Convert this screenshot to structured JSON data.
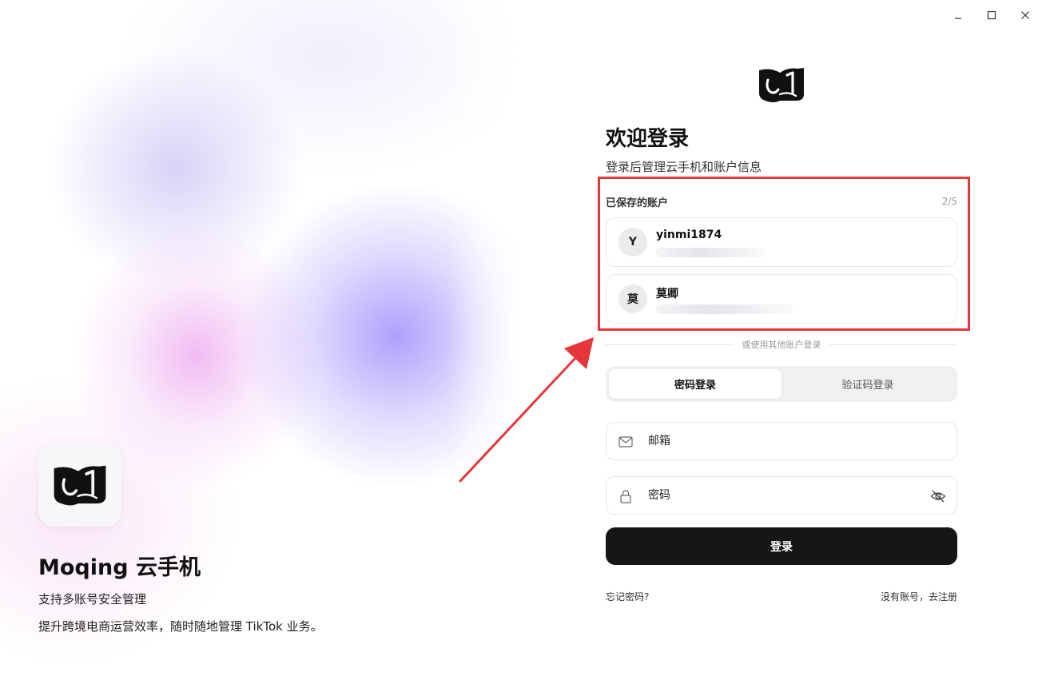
{
  "window": {
    "minimize_icon": "minimize-icon",
    "maximize_icon": "maximize-icon",
    "close_icon": "close-icon"
  },
  "hero": {
    "title": "Moqing 云手机",
    "subtitle1": "支持多账号安全管理",
    "subtitle2": "提升跨境电商运营效率，随时随地管理 TikTok 业务。",
    "logo_icon": "moqing-logo"
  },
  "login": {
    "title": "欢迎登录",
    "subtitle": "登录后管理云手机和账户信息",
    "saved_accounts": {
      "label": "已保存的账户",
      "count": "2/5",
      "items": [
        {
          "avatar": "Y",
          "name": "yinmi1874"
        },
        {
          "avatar": "莫",
          "name": "莫卿"
        }
      ]
    },
    "divider_text": "或使用其他账户登录",
    "tabs": [
      {
        "label": "密码登录",
        "active": true
      },
      {
        "label": "验证码登录",
        "active": false
      }
    ],
    "email_placeholder": "邮箱",
    "password_placeholder": "密码",
    "submit_label": "登录",
    "forgot_label": "忘记密码?",
    "register_label": "没有账号，去注册"
  },
  "colors": {
    "highlight_border": "#e5363a",
    "arrow": "#e5363a",
    "primary_button": "#161616"
  }
}
